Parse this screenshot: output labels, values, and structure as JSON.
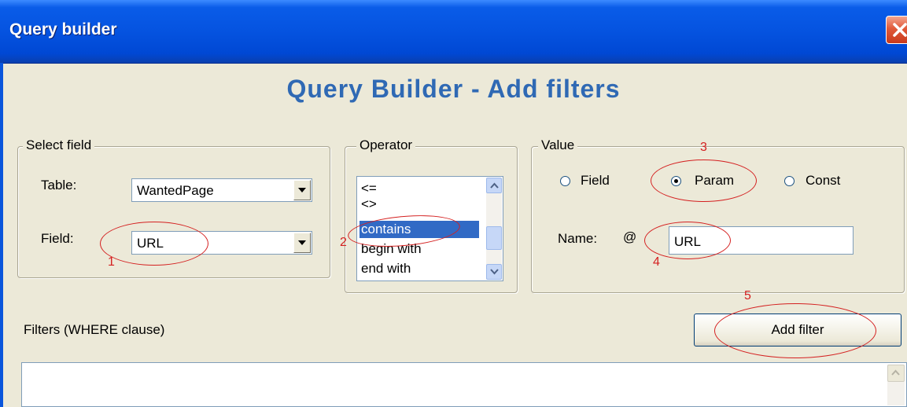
{
  "window": {
    "title": "Query builder"
  },
  "heading": "Query Builder - Add filters",
  "select_field": {
    "legend": "Select field",
    "table_label": "Table:",
    "table_value": "WantedPage",
    "field_label": "Field:",
    "field_value": "URL"
  },
  "operator": {
    "legend": "Operator",
    "items": [
      "<=",
      "<>",
      "contains",
      "begin with",
      "end with"
    ],
    "selected": "contains"
  },
  "value": {
    "legend": "Value",
    "radio_field": "Field",
    "radio_param": "Param",
    "radio_const": "Const",
    "selected": "Param",
    "name_label": "Name:",
    "at_sign": "@",
    "name_value": "URL"
  },
  "filters": {
    "label": "Filters (WHERE clause)",
    "add_button": "Add filter"
  },
  "annotations": [
    "1",
    "2",
    "3",
    "4",
    "5"
  ],
  "colors": {
    "title_bar": "#0553e0",
    "heading": "#2f69b4",
    "selection": "#316ac5",
    "annotation": "#d42020"
  }
}
